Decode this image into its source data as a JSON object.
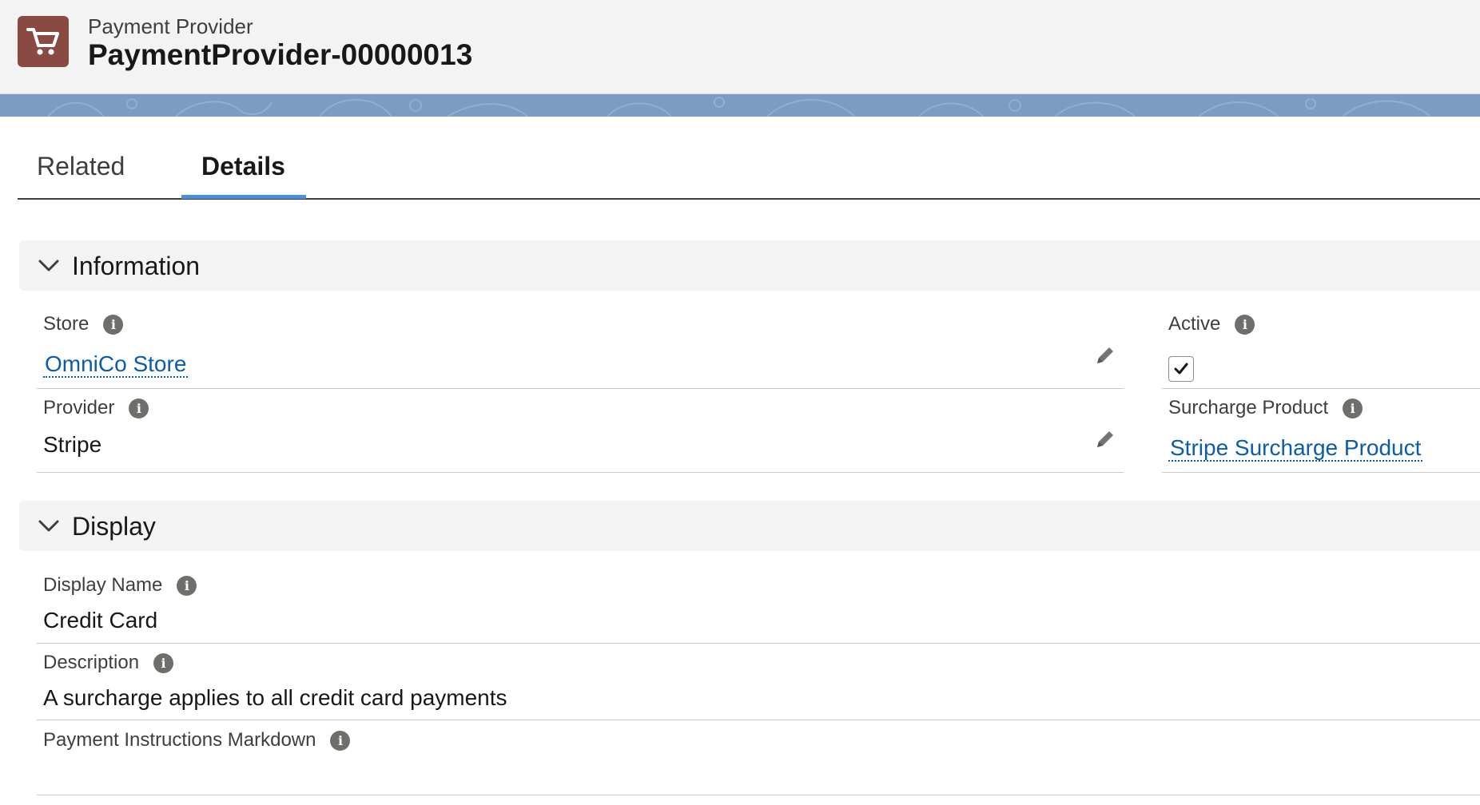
{
  "header": {
    "icon": "shopping-cart-icon",
    "object_type": "Payment Provider",
    "record_name": "PaymentProvider-00000013",
    "icon_color": "#8a4a44"
  },
  "tabs": [
    {
      "label": "Related",
      "active": false
    },
    {
      "label": "Details",
      "active": true
    }
  ],
  "sections": {
    "information": {
      "title": "Information",
      "fields": {
        "store": {
          "label": "Store",
          "value": "OmniCo Store",
          "is_link": true
        },
        "active": {
          "label": "Active",
          "checked": true
        },
        "provider": {
          "label": "Provider",
          "value": "Stripe"
        },
        "surcharge_product": {
          "label": "Surcharge Product",
          "value": "Stripe Surcharge Product",
          "is_link": true
        }
      }
    },
    "display": {
      "title": "Display",
      "fields": {
        "display_name": {
          "label": "Display Name",
          "value": "Credit Card"
        },
        "description": {
          "label": "Description",
          "value": "A surcharge applies to all credit card payments"
        },
        "payment_instructions": {
          "label": "Payment Instructions Markdown",
          "value": ""
        }
      }
    }
  },
  "colors": {
    "link": "#0b5cab",
    "tab_active_underline": "#4a8fe0",
    "band": "#7d9cc3",
    "section_bg": "#f3f3f3"
  }
}
